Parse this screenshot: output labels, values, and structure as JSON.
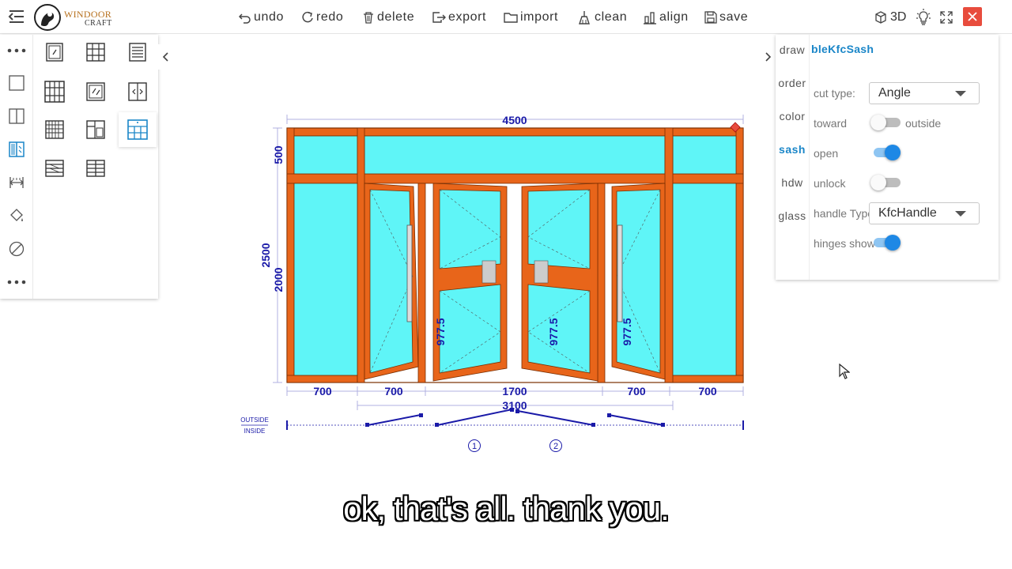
{
  "app": {
    "logo_line1": "WINDOOR",
    "logo_line2": "CRAFT"
  },
  "toolbar": {
    "undo": "undo",
    "redo": "redo",
    "delete": "delete",
    "export": "export",
    "import": "import",
    "clean": "clean",
    "align": "align",
    "save": "save",
    "three_d": "3D"
  },
  "right_panel": {
    "tabs": [
      "draw",
      "order",
      "color",
      "sash",
      "hdw",
      "glass"
    ],
    "active_tab": "sash",
    "title": "bleKfcSash",
    "cut_type": {
      "label": "cut type:",
      "value": "Angle"
    },
    "toward": {
      "label": "toward",
      "value_label": "outside",
      "on": false
    },
    "open": {
      "label": "open",
      "on": true
    },
    "unlock": {
      "label": "unlock",
      "on": false
    },
    "handle_type": {
      "label": "handle Type",
      "value": "KfcHandle"
    },
    "hinges_show": {
      "label": "hinges show",
      "on": true
    }
  },
  "drawing": {
    "overall_width": "4500",
    "top_height": "500",
    "total_height": "2500",
    "lower_height": "2000",
    "bottom_dims": [
      "700",
      "700",
      "1700",
      "700",
      "700"
    ],
    "door_span": "3100",
    "sash_heights": [
      "977.5",
      "977.5",
      "977.5"
    ],
    "side_labels": [
      "OUTSIDE",
      "INSIDE"
    ],
    "sash_numbers": [
      "1",
      "2"
    ],
    "colors": {
      "frame": "#e8651a",
      "glass": "#5ff5f7",
      "dimension": "#1a1aa8",
      "accent": "#1a86c8"
    }
  },
  "subtitle": "ok, that's all. thank you."
}
